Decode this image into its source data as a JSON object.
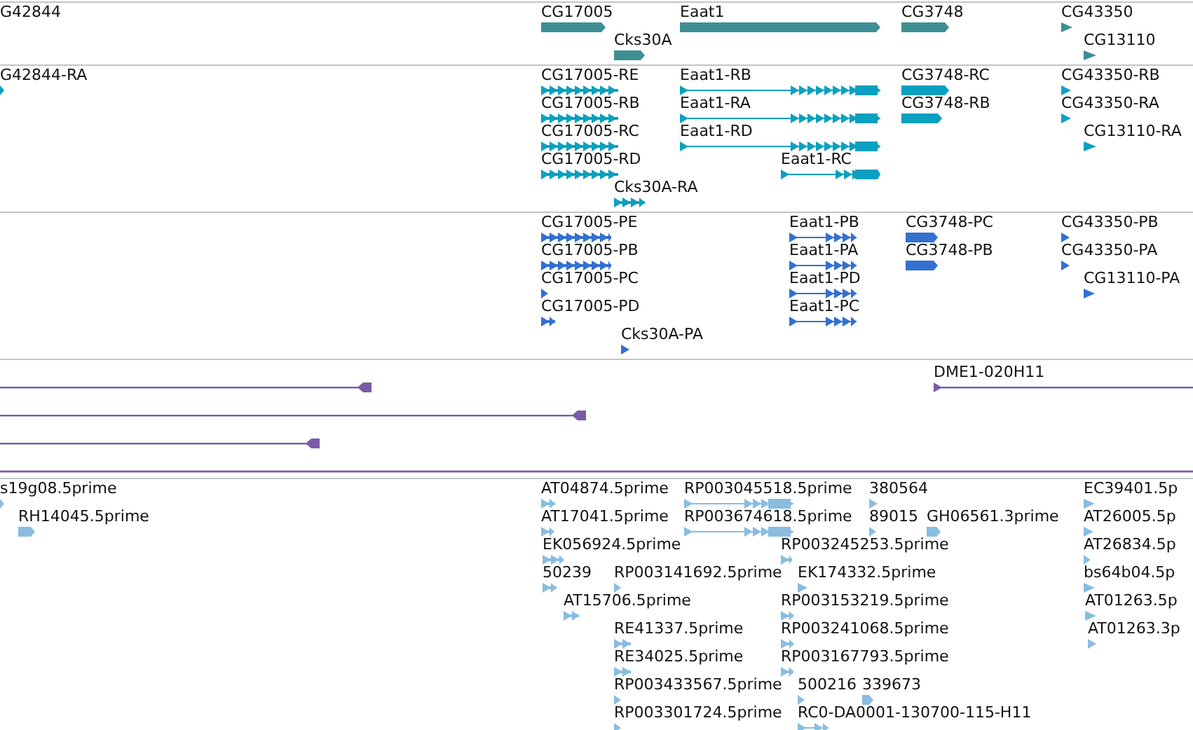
{
  "tracks": [
    {
      "kind": "genes",
      "color": "#3d8f94",
      "features": [
        {
          "label": "G42844"
        },
        {
          "label": "CG17005",
          "kind": "bar"
        },
        {
          "label": "Cks30A",
          "kind": "bar"
        },
        {
          "label": "Eaat1",
          "kind": "bar"
        },
        {
          "label": "CG3748",
          "kind": "bar"
        },
        {
          "label": "CG43350",
          "kind": "tick"
        },
        {
          "label": "CG13110",
          "kind": "tick"
        }
      ]
    },
    {
      "kind": "transcripts",
      "color": "#0aa0c0",
      "features": [
        {
          "label": "G42844-RA",
          "kind": "bar"
        },
        {
          "label": "CG17005-RE",
          "kind": "exons"
        },
        {
          "label": "CG17005-RB",
          "kind": "exons"
        },
        {
          "label": "CG17005-RC",
          "kind": "exons"
        },
        {
          "label": "CG17005-RD",
          "kind": "exons"
        },
        {
          "label": "Cks30A-RA",
          "kind": "exons"
        },
        {
          "label": "Eaat1-RB",
          "kind": "spliced"
        },
        {
          "label": "Eaat1-RA",
          "kind": "spliced"
        },
        {
          "label": "Eaat1-RD",
          "kind": "spliced"
        },
        {
          "label": "Eaat1-RC",
          "kind": "spliced"
        },
        {
          "label": "CG3748-RC",
          "kind": "bar"
        },
        {
          "label": "CG3748-RB",
          "kind": "bar"
        },
        {
          "label": "CG43350-RB",
          "kind": "tick"
        },
        {
          "label": "CG43350-RA",
          "kind": "tick"
        },
        {
          "label": "CG13110-RA",
          "kind": "tick"
        }
      ]
    },
    {
      "kind": "proteins",
      "color": "#3370d0",
      "features": [
        {
          "label": "CG17005-PE",
          "kind": "exons"
        },
        {
          "label": "CG17005-PB",
          "kind": "exons"
        },
        {
          "label": "CG17005-PC",
          "kind": "tick"
        },
        {
          "label": "CG17005-PD",
          "kind": "exons"
        },
        {
          "label": "Cks30A-PA",
          "kind": "tick"
        },
        {
          "label": "Eaat1-PB",
          "kind": "spliced"
        },
        {
          "label": "Eaat1-PA",
          "kind": "spliced"
        },
        {
          "label": "Eaat1-PD",
          "kind": "spliced"
        },
        {
          "label": "Eaat1-PC",
          "kind": "spliced"
        },
        {
          "label": "CG3748-PC",
          "kind": "bar"
        },
        {
          "label": "CG3748-PB",
          "kind": "bar"
        },
        {
          "label": "CG43350-PB",
          "kind": "tick"
        },
        {
          "label": "CG43350-PA",
          "kind": "tick"
        },
        {
          "label": "CG13110-PA",
          "kind": "tick"
        }
      ]
    },
    {
      "kind": "alignments",
      "color": "#7a5aa8",
      "features": [
        {
          "kind": "reverse"
        },
        {
          "kind": "reverse"
        },
        {
          "kind": "reverse"
        },
        {
          "kind": "plain"
        },
        {
          "label": "DME1-020H11",
          "kind": "forward"
        }
      ]
    },
    {
      "kind": "ests",
      "color": "#88bde0",
      "features": [
        {
          "label": "s19g08.5prime",
          "kind": "tick"
        },
        {
          "label": "RH14045.5prime",
          "kind": "bar"
        },
        {
          "label": "AT04874.5prime",
          "kind": "exons"
        },
        {
          "label": "AT17041.5prime",
          "kind": "exons"
        },
        {
          "label": "EK056924.5prime",
          "kind": "exons"
        },
        {
          "label": "50239",
          "kind": "exons"
        },
        {
          "label": "AT15706.5prime",
          "kind": "exons"
        },
        {
          "label": "RP003045518.5prime",
          "kind": "spliced"
        },
        {
          "label": "RP003674618.5prime",
          "kind": "spliced"
        },
        {
          "label": "RP003141692.5prime",
          "kind": "tick"
        },
        {
          "label": "RE41337.5prime",
          "kind": "exons"
        },
        {
          "label": "RE34025.5prime",
          "kind": "exons"
        },
        {
          "label": "RP003433567.5prime",
          "kind": "tick"
        },
        {
          "label": "RP003301724.5prime",
          "kind": "tick"
        },
        {
          "label": "380564",
          "kind": "tick"
        },
        {
          "label": "89015",
          "kind": "tick"
        },
        {
          "label": "GH06561.3prime",
          "kind": "bar"
        },
        {
          "label": "RP003245253.5prime",
          "kind": "exons"
        },
        {
          "label": "EK174332.5prime",
          "kind": "tick"
        },
        {
          "label": "RP003153219.5prime",
          "kind": "exons"
        },
        {
          "label": "RP003241068.5prime",
          "kind": "exons"
        },
        {
          "label": "RP003167793.5prime",
          "kind": "exons"
        },
        {
          "label": "500216",
          "kind": "tick"
        },
        {
          "label": "339673",
          "kind": "bar"
        },
        {
          "label": "RC0-DA0001-130700-115-H11",
          "kind": "spliced"
        },
        {
          "label": "EC39401.5p",
          "kind": "tick"
        },
        {
          "label": "AT26005.5p",
          "kind": "tick"
        },
        {
          "label": "AT26834.5p",
          "kind": "tick"
        },
        {
          "label": "bs64b04.5p",
          "kind": "tick"
        },
        {
          "label": "AT01263.5p",
          "kind": "tick"
        },
        {
          "label": "AT01263.3p",
          "kind": "tick"
        }
      ]
    }
  ]
}
